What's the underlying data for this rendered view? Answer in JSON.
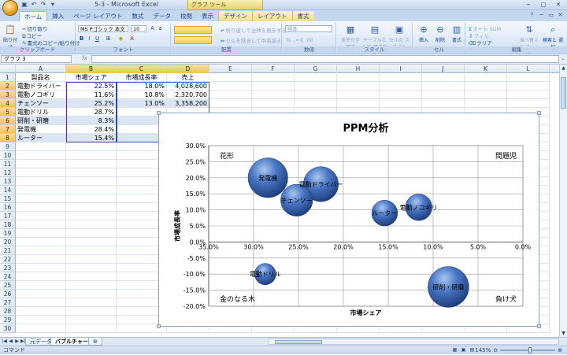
{
  "window": {
    "title": "5-3 - Microsoft Excel",
    "context_group": "グラフ ツール"
  },
  "ribbon_tabs": [
    "ホーム",
    "挿入",
    "ページ レイアウト",
    "数式",
    "データ",
    "校閲",
    "表示",
    "デザイン",
    "レイアウト",
    "書式"
  ],
  "ribbon": {
    "clipboard": {
      "paste": "貼り付け",
      "cut": "切り取り",
      "copy": "コピー",
      "format_painter": "書式のコピー/貼り付け",
      "label": "クリップボード"
    },
    "font": {
      "name": "MS Pゴシック 本文",
      "size": "10",
      "label": "フォント"
    },
    "alignment": {
      "wrap": "折り返して全体を表示する",
      "merge": "セルを結合して中央揃え",
      "label": "配置"
    },
    "number": {
      "format": "標準",
      "label": "数値"
    },
    "styles": {
      "conditional": "条件付き 書式",
      "table": "テーブルとして 書式設定",
      "cell": "セルの スタイル",
      "label": "スタイル"
    },
    "cells": {
      "insert": "挿入",
      "delete": "削除",
      "format": "書式",
      "label": "セル"
    },
    "editing": {
      "autosum": "オート SUM",
      "fill": "フィル",
      "clear": "クリア",
      "sort": "並べ替えと フィルタ",
      "find": "検索と 選択",
      "label": "編集"
    }
  },
  "formula_bar": {
    "name_box": "グラフ 3",
    "fx": "fx"
  },
  "columns": [
    "A",
    "B",
    "C",
    "D",
    "E",
    "F",
    "G",
    "H",
    "I",
    "J",
    "K",
    "L"
  ],
  "rows": [
    "1",
    "2",
    "3",
    "4",
    "5",
    "6",
    "7",
    "8",
    "9",
    "10",
    "11",
    "12",
    "13",
    "14",
    "15",
    "16",
    "17",
    "18",
    "19",
    "20",
    "21",
    "22",
    "23",
    "24",
    "25",
    "26",
    "27",
    "28",
    "29",
    "30"
  ],
  "table": {
    "headers": [
      "製品名",
      "市場シェア",
      "市場成長率",
      "売上"
    ],
    "rows": [
      [
        "電動ドライバー",
        "22.5%",
        "18.0%",
        "4,028,600"
      ],
      [
        "電動ノコギリ",
        "11.6%",
        "10.8%",
        "2,320,700"
      ],
      [
        "チェンソー",
        "25.2%",
        "13.0%",
        "3,358,200"
      ],
      [
        "電動ドリル",
        "28.7%",
        "",
        ""
      ],
      [
        "研削・研磨",
        "8.3%",
        "",
        ""
      ],
      [
        "発電機",
        "28.4%",
        "",
        ""
      ],
      [
        "ルーター",
        "15.4%",
        "",
        ""
      ]
    ]
  },
  "chart_data": {
    "type": "scatter",
    "subtype": "bubble",
    "title": "PPM分析",
    "xlabel": "市場シェア",
    "ylabel": "市場成長率",
    "xlim": [
      0.35,
      0.0
    ],
    "x_reversed": true,
    "ylim": [
      -0.2,
      0.3
    ],
    "x_ticks": [
      "35.0%",
      "30.0%",
      "25.0%",
      "20.0%",
      "15.0%",
      "10.0%",
      "5.0%",
      "0.0%"
    ],
    "y_ticks": [
      "30.0%",
      "25.0%",
      "20.0%",
      "15.0%",
      "10.0%",
      "5.0%",
      "0.0%",
      "-5.0%",
      "-10.0%",
      "-15.0%",
      "-20.0%"
    ],
    "grid": true,
    "quadrant_labels": [
      "花形",
      "問題児",
      "金のなる木",
      "負け犬"
    ],
    "color": "#4a76c4",
    "points": [
      {
        "label": "発電機",
        "x": 0.284,
        "y": 0.2,
        "size": 5.2
      },
      {
        "label": "電動ドライバー",
        "x": 0.225,
        "y": 0.18,
        "size": 4.03
      },
      {
        "label": "チェンソー",
        "x": 0.252,
        "y": 0.13,
        "size": 3.36
      },
      {
        "label": "ルーター",
        "x": 0.154,
        "y": 0.09,
        "size": 2.2
      },
      {
        "label": "電動ノコギリ",
        "x": 0.116,
        "y": 0.108,
        "size": 2.32
      },
      {
        "label": "電動ドリル",
        "x": 0.287,
        "y": -0.1,
        "size": 1.5
      },
      {
        "label": "研削・研磨",
        "x": 0.083,
        "y": -0.14,
        "size": 5.5
      }
    ]
  },
  "sheets": [
    "元データ",
    "バブルチャート"
  ],
  "status": {
    "mode": "コマンド",
    "zoom": "145%"
  }
}
